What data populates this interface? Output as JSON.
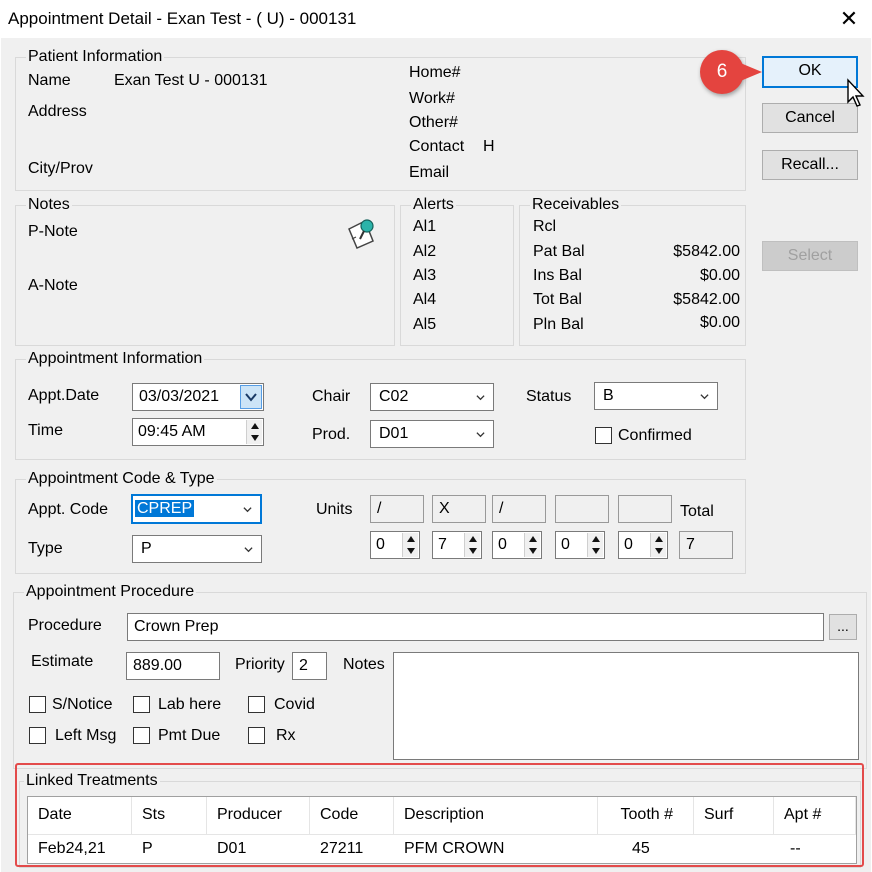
{
  "window": {
    "title": "Appointment Detail - Exan Test - ( U) - 000131",
    "close_glyph": "✕"
  },
  "buttons": {
    "ok": "OK",
    "cancel": "Cancel",
    "recall": "Recall...",
    "select": "Select",
    "browse": "..."
  },
  "callout": {
    "step": "6"
  },
  "patient": {
    "legend": "Patient Information",
    "name_label": "Name",
    "name_value": "Exan Test  U - 000131",
    "address_label": "Address",
    "city_label": "City/Prov",
    "home_label": "Home#",
    "work_label": "Work#",
    "other_label": "Other#",
    "contact_label": "Contact",
    "contact_value": "H",
    "email_label": "Email"
  },
  "notes": {
    "legend": "Notes",
    "p_note": "P-Note",
    "a_note": "A-Note",
    "icon": "notepad-pin-icon"
  },
  "alerts": {
    "legend": "Alerts",
    "items": [
      "Al1",
      "Al2",
      "Al3",
      "Al4",
      "Al5"
    ]
  },
  "receivables": {
    "legend": "Receivables",
    "rcl_label": "Rcl",
    "rows": [
      {
        "label": "Pat Bal",
        "value": "$5842.00"
      },
      {
        "label": "Ins Bal",
        "value": "$0.00"
      },
      {
        "label": "Tot Bal",
        "value": "$5842.00"
      },
      {
        "label": "Pln Bal",
        "value": "$0.00"
      }
    ]
  },
  "appointment": {
    "legend": "Appointment Information",
    "date_label": "Appt.Date",
    "date_value": "03/03/2021",
    "time_label": "Time",
    "time_value": "09:45 AM",
    "chair_label": "Chair",
    "chair_value": "C02",
    "prod_label": "Prod.",
    "prod_value": "D01",
    "status_label": "Status",
    "status_value": "B",
    "confirmed_label": "Confirmed"
  },
  "code_type": {
    "legend": "Appointment Code & Type",
    "code_label": "Appt. Code",
    "code_value": "CPREP",
    "type_label": "Type",
    "type_value": "P",
    "units_label": "Units",
    "unit_marks": [
      "/",
      "X",
      "/",
      "",
      ""
    ],
    "unit_values": [
      "0",
      "7",
      "0",
      "0",
      "0"
    ],
    "total_label": "Total",
    "total_value": "7"
  },
  "procedure": {
    "legend": "Appointment Procedure",
    "procedure_label": "Procedure",
    "procedure_value": "Crown Prep",
    "estimate_label": "Estimate",
    "estimate_value": "889.00",
    "priority_label": "Priority",
    "priority_value": "2",
    "notes_label": "Notes",
    "checks": [
      "S/Notice",
      "Lab here",
      "Covid",
      "Left Msg",
      "Pmt Due",
      "Rx"
    ]
  },
  "linked": {
    "legend": "Linked Treatments",
    "columns": [
      "Date",
      "Sts",
      "Producer",
      "Code",
      "Description",
      "Tooth #",
      "Surf",
      "Apt #"
    ],
    "rows": [
      [
        "Feb24,21",
        "P",
        "D01",
        "27211",
        "PFM CROWN",
        "45",
        "",
        "--"
      ]
    ]
  }
}
